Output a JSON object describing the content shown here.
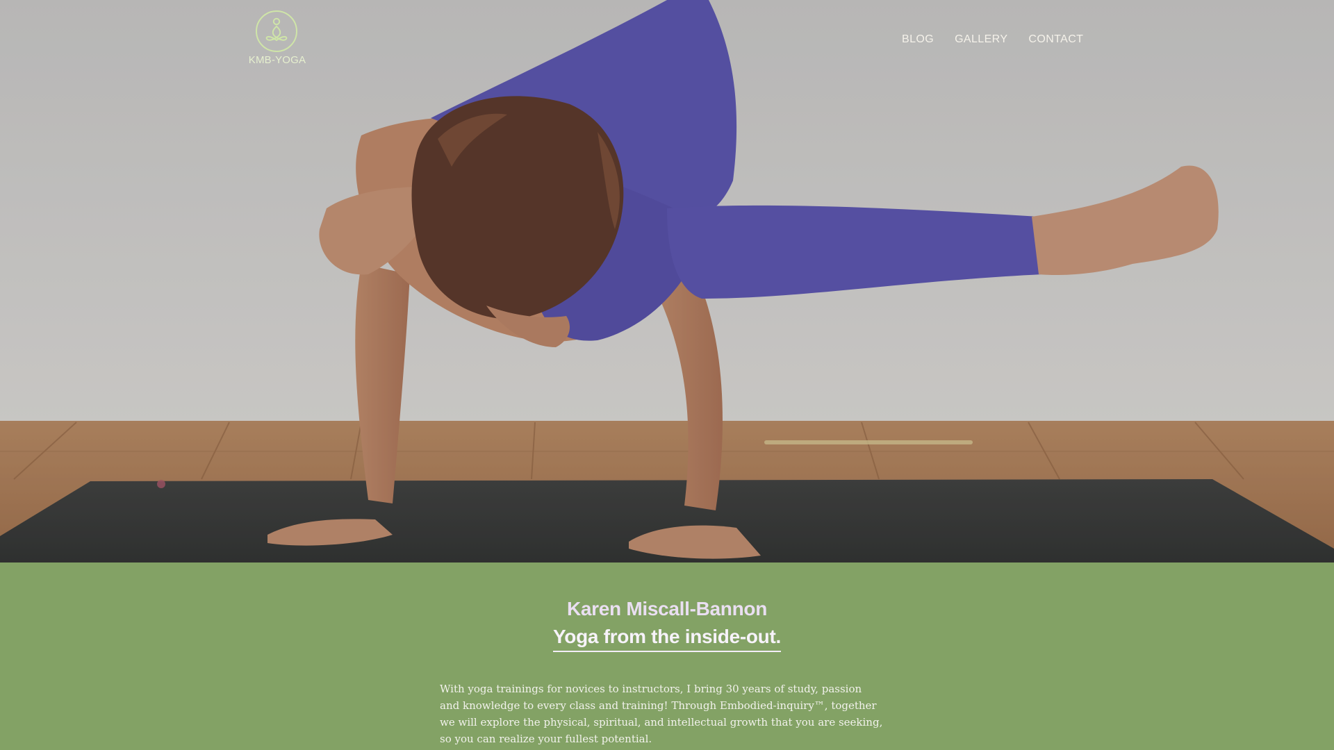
{
  "header": {
    "logo_text": "KMB-YOGA",
    "nav": [
      {
        "label": "BLOG"
      },
      {
        "label": "GALLERY"
      },
      {
        "label": "CONTACT"
      }
    ]
  },
  "hero": {
    "image": "yoga-arm-balance-photo"
  },
  "intro": {
    "name": "Karen Miscall-Bannon",
    "tagline": "Yoga from the inside-out.",
    "body": "With yoga trainings for novices to instructors, I bring 30 years of study, passion and knowledge to every class and training! Through Embodied-inquiry™, together we will explore the physical, spiritual, and intellectual growth that you are seeking, so you can realize your fullest potential."
  },
  "colors": {
    "section_green": "#83a265",
    "logo_green": "#cfe5a8",
    "nav_text": "#f5f2ea",
    "name_lavender": "#eadff2"
  }
}
